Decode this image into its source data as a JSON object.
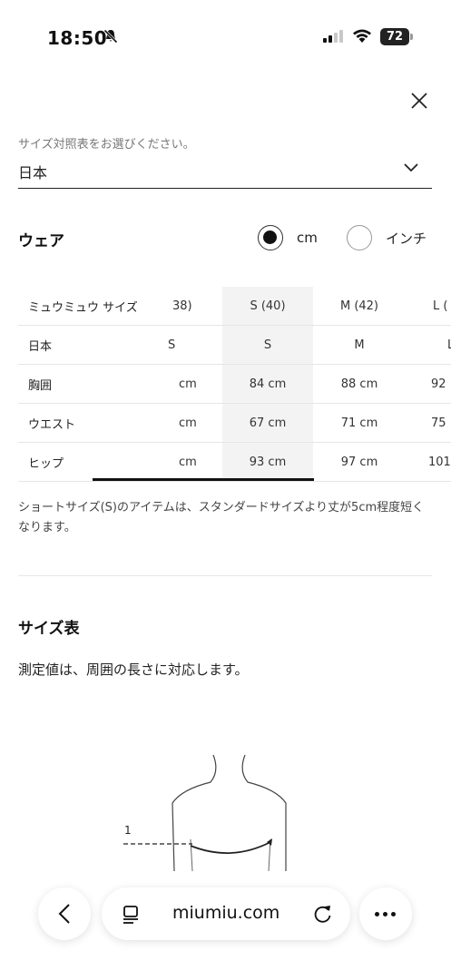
{
  "status_bar": {
    "time": "18:50",
    "battery": "72"
  },
  "country": {
    "label": "サイズ対照表をお選びください。",
    "value": "日本"
  },
  "wear": {
    "title": "ウェア",
    "units": [
      {
        "label": "cm",
        "selected": true
      },
      {
        "label": "インチ",
        "selected": false
      }
    ]
  },
  "size_table": {
    "header_label": "ミュウミュウ サイズ",
    "row_labels": [
      "日本",
      "胸囲",
      "ウエスト",
      "ヒップ"
    ],
    "columns": [
      {
        "size": "38)",
        "values": [
          "S",
          "cm",
          "cm",
          "cm"
        ]
      },
      {
        "size": "S (40)",
        "values": [
          "S",
          "84 cm",
          "67 cm",
          "93 cm"
        ]
      },
      {
        "size": "M (42)",
        "values": [
          "M",
          "88 cm",
          "71 cm",
          "97 cm"
        ]
      },
      {
        "size": "L (",
        "values": [
          "L",
          "92",
          "75",
          "101"
        ]
      }
    ]
  },
  "note": "ショートサイズ(S)のアイテムは、スタンダードサイズより丈が5cm程度短くなります。",
  "size_chart": {
    "title": "サイズ表",
    "description": "測定値は、周囲の長さに対応します。",
    "measure_number": "1"
  },
  "browser": {
    "url": "miumiu.com"
  }
}
